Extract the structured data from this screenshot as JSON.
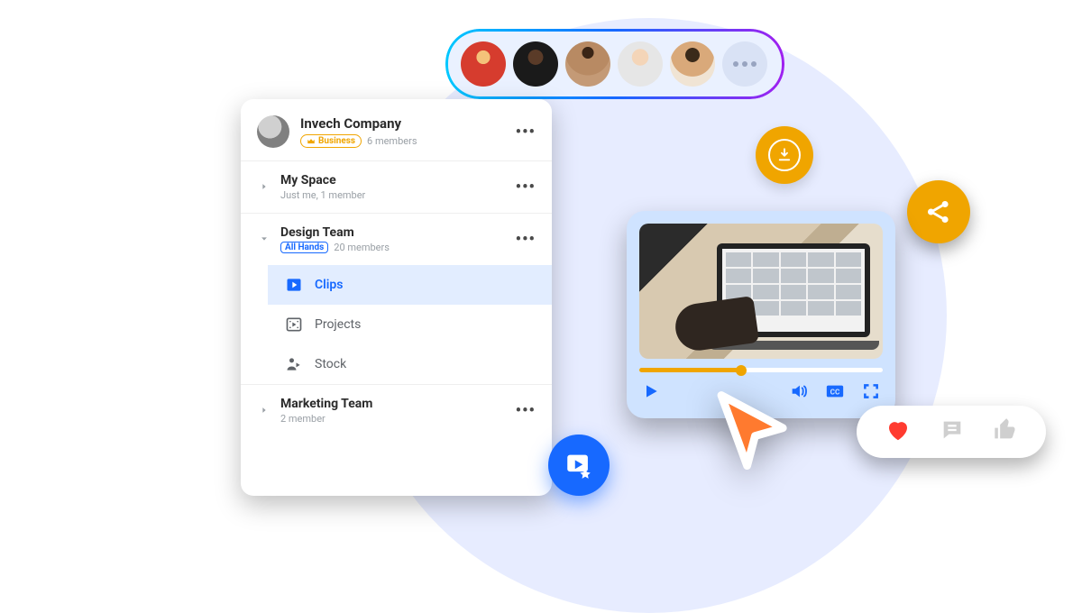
{
  "workspace": {
    "name": "Invech Company",
    "plan_badge": "Business",
    "members_text": "6 members"
  },
  "spaces": [
    {
      "name": "My Space",
      "subtitle": "Just me, 1 member",
      "expanded": false
    },
    {
      "name": "Design Team",
      "badge": "All Hands",
      "members_text": "20 members",
      "expanded": true,
      "folders": [
        {
          "name": "Clips",
          "icon": "play",
          "active": true
        },
        {
          "name": "Projects",
          "icon": "film",
          "active": false
        },
        {
          "name": "Stock",
          "icon": "person-play",
          "active": false
        }
      ]
    },
    {
      "name": "Marketing Team",
      "subtitle": "2 member",
      "expanded": false
    }
  ],
  "avatar_strip": {
    "count": 5,
    "show_more": true
  },
  "player": {
    "progress_pct": 42,
    "controls": [
      "play",
      "volume",
      "cc",
      "fullscreen"
    ]
  },
  "reactions": [
    "heart",
    "comment",
    "thumbs-up"
  ],
  "colors": {
    "accent": "#1769ff",
    "accent_amber": "#f0a500",
    "cursor": "#ff7a2f",
    "heart": "#ff3b30"
  }
}
